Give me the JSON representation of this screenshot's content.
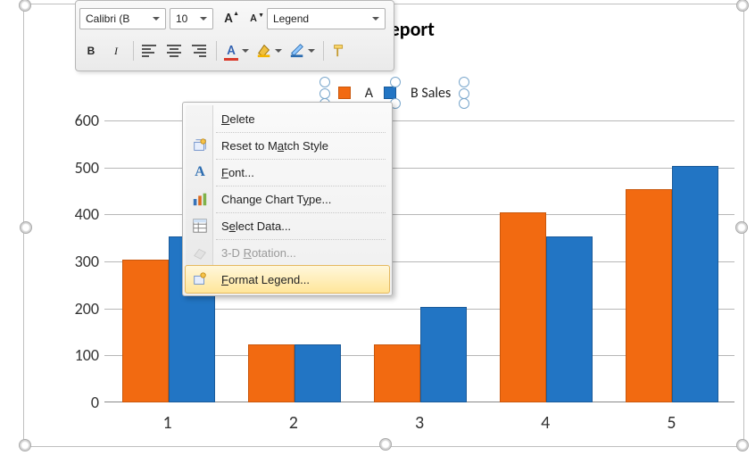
{
  "chart_data": {
    "type": "bar",
    "title": "Sales Report",
    "categories": [
      "1",
      "2",
      "3",
      "4",
      "5"
    ],
    "series": [
      {
        "name": "A",
        "color": "#f26a11",
        "values": [
          300,
          120,
          120,
          400,
          450
        ]
      },
      {
        "name": "B Sales",
        "color": "#2275c4",
        "values": [
          350,
          120,
          200,
          350,
          500
        ]
      }
    ],
    "ylim": [
      0,
      600
    ],
    "yticks": [
      0,
      100,
      200,
      300,
      400,
      500,
      600
    ],
    "xlabel": "",
    "ylabel": "",
    "legend_position": "top"
  },
  "mini_toolbar": {
    "font_name": "Calibri (B",
    "font_size": "10",
    "element_box": "Legend",
    "bold_label": "B",
    "italic_label": "I"
  },
  "context_menu": {
    "items": [
      {
        "key": "delete",
        "label_before": "",
        "u": "D",
        "label_after": "elete"
      },
      {
        "key": "reset",
        "label_before": "Reset to M",
        "u": "a",
        "label_after": "tch Style"
      },
      {
        "key": "font",
        "label_before": "",
        "u": "F",
        "label_after": "ont..."
      },
      {
        "key": "chart_type",
        "label_before": "Change Chart T",
        "u": "y",
        "label_after": "pe..."
      },
      {
        "key": "select_data",
        "label_before": "S",
        "u": "e",
        "label_after": "lect Data..."
      },
      {
        "key": "rotation",
        "label_before": "3-D ",
        "u": "R",
        "label_after": "otation..."
      },
      {
        "key": "format_legend",
        "label_before": "",
        "u": "F",
        "label_after": "ormat Legend..."
      }
    ]
  }
}
